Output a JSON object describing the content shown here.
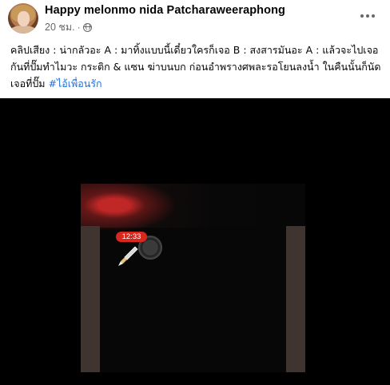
{
  "post": {
    "author_name": "Happy melonmo nida Patcharaweeraphong",
    "timestamp": "20 ชม.",
    "separator": "·",
    "privacy_icon": "globe-icon",
    "more_icon": "more-horizontal-icon",
    "caption": "คลิปเสียง : น่ากลัวอะ A : มาทิ้งแบบนี้เดี๋ยวใครก็เจอ B : สงสารมันอะ A : แล้วจะไปเจอกันที่ปั๊มทำไมวะ กระติก & แซน ฆ่าบนบก ก่อนอำพรางศพละรอโยนลงน้ำ ในคืนนั้นก็นัดเจอที่ปั๊ม ",
    "hashtag": "#ไอ้เพื่อนรัก"
  },
  "video": {
    "time_label": "12:33",
    "knife_icon": "knife-icon",
    "record_icon": "record-button-icon",
    "accent_color": "#d8281e"
  },
  "colors": {
    "hashtag": "#216fdb",
    "meta_text": "#65676b"
  }
}
